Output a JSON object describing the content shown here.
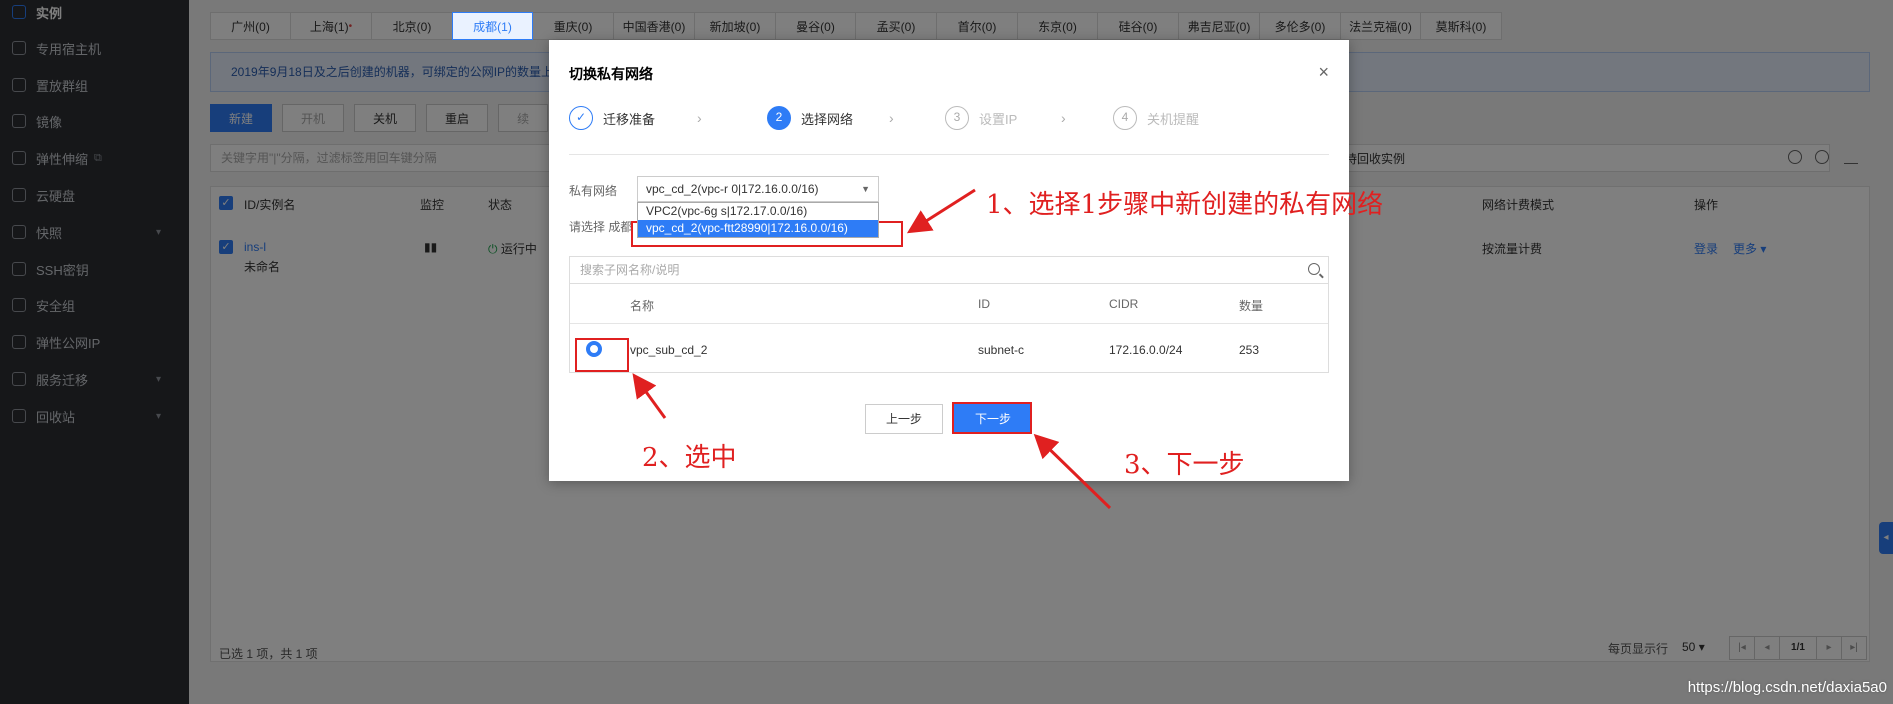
{
  "sidebar": {
    "items": [
      {
        "label": "实例",
        "active": true
      },
      {
        "label": "专用宿主机"
      },
      {
        "label": "置放群组"
      },
      {
        "label": "镜像"
      },
      {
        "label": "弹性伸缩",
        "ext": "⧉"
      },
      {
        "label": "云硬盘"
      },
      {
        "label": "快照",
        "caret": "▾"
      },
      {
        "label": "SSH密钥"
      },
      {
        "label": "安全组"
      },
      {
        "label": "弹性公网IP"
      },
      {
        "label": "服务迁移",
        "caret": "▾"
      },
      {
        "label": "回收站",
        "caret": "▾"
      }
    ]
  },
  "regions": [
    {
      "label": "广州(0)"
    },
    {
      "label": "上海(1)",
      "dot": "•"
    },
    {
      "label": "北京(0)"
    },
    {
      "label": "成都(1)",
      "active": true
    },
    {
      "label": "重庆(0)"
    },
    {
      "label": "中国香港(0)"
    },
    {
      "label": "新加坡(0)"
    },
    {
      "label": "曼谷(0)"
    },
    {
      "label": "孟买(0)"
    },
    {
      "label": "首尔(0)"
    },
    {
      "label": "东京(0)"
    },
    {
      "label": "硅谷(0)"
    },
    {
      "label": "弗吉尼亚(0)"
    },
    {
      "label": "多伦多(0)"
    },
    {
      "label": "法兰克福(0)"
    },
    {
      "label": "莫斯科(0)"
    }
  ],
  "notice": "2019年9月18日及之后创建的机器，可绑定的公网IP的数量上",
  "toolbar": {
    "new": "新建",
    "start": "开机",
    "stop": "关机",
    "restart": "重启",
    "more": "续"
  },
  "search_placeholder": "关键字用\"|\"分隔，过滤标签用回车键分隔",
  "recycle_text": "待回收实例",
  "table": {
    "headers": {
      "id": "ID/实例名",
      "monitor": "监控",
      "status": "状态",
      "billing": "网络计费模式",
      "ops": "操作"
    },
    "row": {
      "id": "ins-l",
      "name": "未命名",
      "status": "运行中",
      "billing": "按流量计费",
      "login": "登录",
      "more": "更多"
    }
  },
  "footer": {
    "selected": "已选 1 项，共 1 项",
    "page_size_label": "每页显示行",
    "page_size": "50",
    "page": "1/1"
  },
  "watermark": "https://blog.csdn.net/daxia5a0",
  "modal": {
    "title": "切换私有网络",
    "close": "×",
    "steps": [
      {
        "num": "✓",
        "label": "迁移准备",
        "state": "done"
      },
      {
        "num": "2",
        "label": "选择网络",
        "state": "current"
      },
      {
        "num": "3",
        "label": "设置IP",
        "state": "todo"
      },
      {
        "num": "4",
        "label": "关机提醒",
        "state": "todo"
      }
    ],
    "step_sep": "›",
    "vpc_label": "私有网络",
    "vpc_selected": "vpc_cd_2(vpc-r        0|172.16.0.0/16)",
    "vpc_options": [
      {
        "label": "VPC2(vpc-6g        s|172.17.0.0/16)"
      },
      {
        "label": "vpc_cd_2(vpc-ftt28990|172.16.0.0/16)",
        "selected": true
      }
    ],
    "subnet_label": "请选择 成都",
    "subnet_search_placeholder": "搜索子网名称/说明",
    "subnet_headers": {
      "name": "名称",
      "id": "ID",
      "cidr": "CIDR",
      "count": "数量"
    },
    "subnet_row": {
      "name": "vpc_sub_cd_2",
      "id": "subnet-c",
      "cidr": "172.16.0.0/24",
      "count": "253"
    },
    "prev": "上一步",
    "next": "下一步"
  },
  "annotations": {
    "a1": "1、选择1步骤中新创建的私有网络",
    "a2": "2、选中",
    "a3": "3、下一步",
    "color": "#e02020"
  }
}
